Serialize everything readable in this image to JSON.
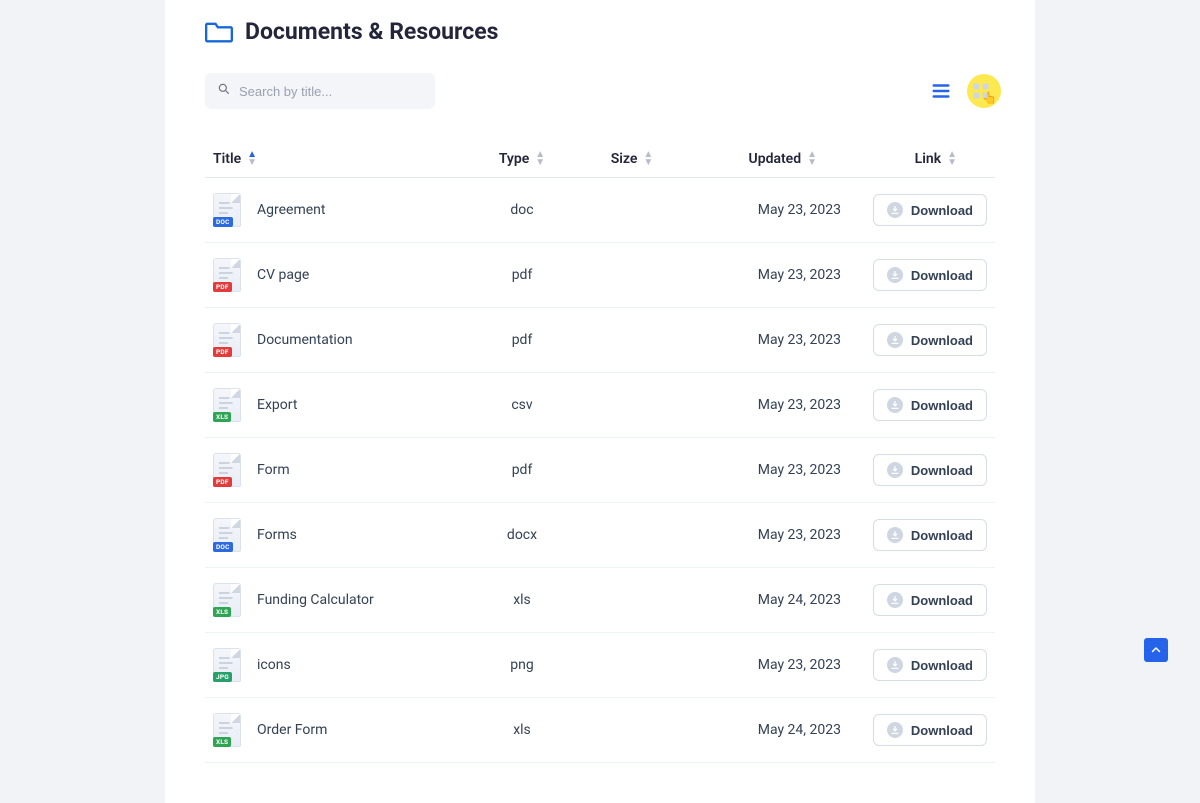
{
  "header": {
    "title": "Documents & Resources"
  },
  "search": {
    "placeholder": "Search by title...",
    "value": ""
  },
  "viewToggle": {
    "list_active": true,
    "grid_active": false
  },
  "table": {
    "columns": {
      "title": "Title",
      "type": "Type",
      "size": "Size",
      "updated": "Updated",
      "link": "Link"
    },
    "sort": {
      "column": "title",
      "dir": "asc"
    },
    "download_label": "Download",
    "rows": [
      {
        "title": "Agreement",
        "type": "doc",
        "size": "",
        "updated": "May 23, 2023",
        "badge": "DOC",
        "badgeClass": "doc"
      },
      {
        "title": "CV page",
        "type": "pdf",
        "size": "",
        "updated": "May 23, 2023",
        "badge": "PDF",
        "badgeClass": "pdf"
      },
      {
        "title": "Documentation",
        "type": "pdf",
        "size": "",
        "updated": "May 23, 2023",
        "badge": "PDF",
        "badgeClass": "pdf"
      },
      {
        "title": "Export",
        "type": "csv",
        "size": "",
        "updated": "May 23, 2023",
        "badge": "XLS",
        "badgeClass": "xls"
      },
      {
        "title": "Form",
        "type": "pdf",
        "size": "",
        "updated": "May 23, 2023",
        "badge": "PDF",
        "badgeClass": "pdf"
      },
      {
        "title": "Forms",
        "type": "docx",
        "size": "",
        "updated": "May 23, 2023",
        "badge": "DOC",
        "badgeClass": "doc"
      },
      {
        "title": "Funding Calculator",
        "type": "xls",
        "size": "",
        "updated": "May 24, 2023",
        "badge": "XLS",
        "badgeClass": "xls"
      },
      {
        "title": "icons",
        "type": "png",
        "size": "",
        "updated": "May 23, 2023",
        "badge": "JPG",
        "badgeClass": "jpg"
      },
      {
        "title": "Order Form",
        "type": "xls",
        "size": "",
        "updated": "May 24, 2023",
        "badge": "XLS",
        "badgeClass": "xls"
      }
    ]
  }
}
